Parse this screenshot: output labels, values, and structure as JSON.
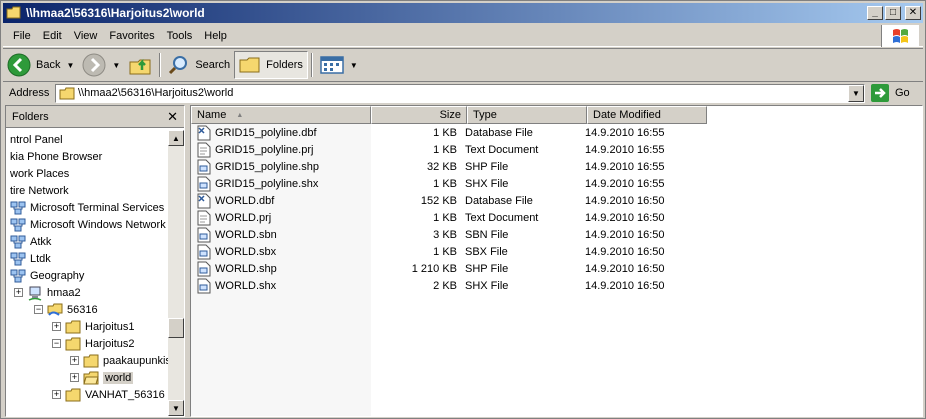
{
  "window": {
    "title": "\\\\hmaa2\\56316\\Harjoitus2\\world",
    "controls": {
      "minimize": "_",
      "maximize": "□",
      "close": "✕"
    }
  },
  "menu": [
    "File",
    "Edit",
    "View",
    "Favorites",
    "Tools",
    "Help"
  ],
  "toolbar": {
    "back": "Back",
    "search": "Search",
    "folders": "Folders"
  },
  "address": {
    "label": "Address",
    "value": "\\\\hmaa2\\56316\\Harjoitus2\\world",
    "go": "Go"
  },
  "folders_pane": {
    "title": "Folders",
    "close": "✕",
    "tree": [
      {
        "label": "ntrol Panel",
        "icon": "control-panel-icon"
      },
      {
        "label": "kia Phone Browser",
        "icon": "phone-icon"
      },
      {
        "label": "work Places",
        "icon": "network-places-icon"
      },
      {
        "label": "tire Network",
        "icon": "network-icon"
      },
      {
        "label": "Microsoft Terminal Services",
        "icon": "network-icon"
      },
      {
        "label": "Microsoft Windows Network",
        "icon": "network-icon"
      },
      {
        "label": "Atkk",
        "icon": "domain-icon"
      },
      {
        "label": "Ltdk",
        "icon": "domain-icon"
      },
      {
        "label": "Geography",
        "icon": "domain-icon"
      },
      {
        "label": "hmaa2",
        "icon": "computer-icon",
        "expander": "+"
      },
      {
        "label": "56316",
        "icon": "shared-folder-icon",
        "expander": "−"
      },
      {
        "label": "Harjoitus1",
        "icon": "folder-icon",
        "expander": "+"
      },
      {
        "label": "Harjoitus2",
        "icon": "folder-icon",
        "expander": "−"
      },
      {
        "label": "paakaupunkis",
        "icon": "folder-icon",
        "expander": "+"
      },
      {
        "label": "world",
        "icon": "folder-open-icon",
        "expander": "+",
        "selected": true
      },
      {
        "label": "VANHAT_56316",
        "icon": "folder-icon",
        "expander": "+"
      }
    ]
  },
  "file_list": {
    "columns": {
      "name": "Name",
      "size": "Size",
      "type": "Type",
      "date": "Date Modified"
    },
    "rows": [
      {
        "name": "GRID15_polyline.dbf",
        "size": "1 KB",
        "type": "Database File",
        "date": "14.9.2010 16:55",
        "icon": "dbf-file-icon"
      },
      {
        "name": "GRID15_polyline.prj",
        "size": "1 KB",
        "type": "Text Document",
        "date": "14.9.2010 16:55",
        "icon": "text-file-icon"
      },
      {
        "name": "GRID15_polyline.shp",
        "size": "32 KB",
        "type": "SHP File",
        "date": "14.9.2010 16:55",
        "icon": "generic-file-icon"
      },
      {
        "name": "GRID15_polyline.shx",
        "size": "1 KB",
        "type": "SHX File",
        "date": "14.9.2010 16:55",
        "icon": "generic-file-icon"
      },
      {
        "name": "WORLD.dbf",
        "size": "152 KB",
        "type": "Database File",
        "date": "14.9.2010 16:50",
        "icon": "dbf-file-icon"
      },
      {
        "name": "WORLD.prj",
        "size": "1 KB",
        "type": "Text Document",
        "date": "14.9.2010 16:50",
        "icon": "text-file-icon"
      },
      {
        "name": "WORLD.sbn",
        "size": "3 KB",
        "type": "SBN File",
        "date": "14.9.2010 16:50",
        "icon": "generic-file-icon"
      },
      {
        "name": "WORLD.sbx",
        "size": "1 KB",
        "type": "SBX File",
        "date": "14.9.2010 16:50",
        "icon": "generic-file-icon"
      },
      {
        "name": "WORLD.shp",
        "size": "1 210 KB",
        "type": "SHP File",
        "date": "14.9.2010 16:50",
        "icon": "generic-file-icon"
      },
      {
        "name": "WORLD.shx",
        "size": "2 KB",
        "type": "SHX File",
        "date": "14.9.2010 16:50",
        "icon": "generic-file-icon"
      }
    ]
  }
}
